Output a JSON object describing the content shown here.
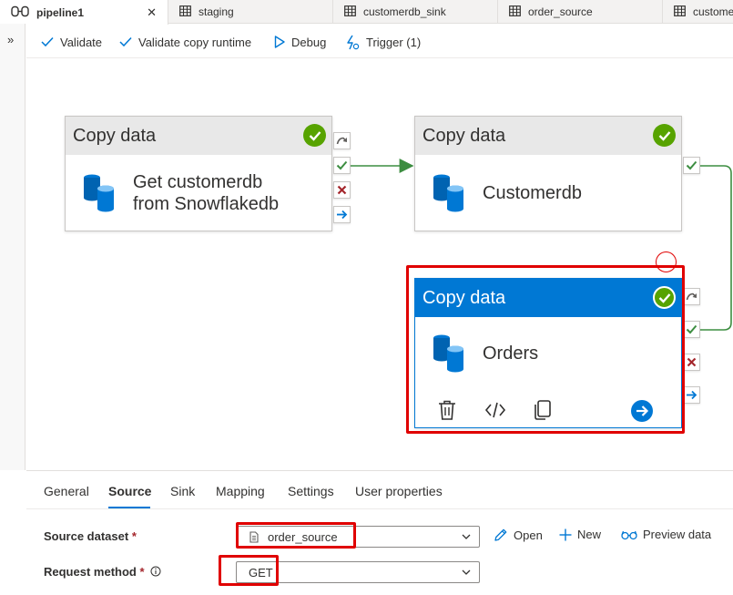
{
  "tabs": [
    {
      "label": "pipeline1",
      "icon": "pipeline-icon",
      "active": true,
      "close": "✕"
    },
    {
      "label": "staging",
      "icon": "table-icon"
    },
    {
      "label": "customerdb_sink",
      "icon": "table-icon"
    },
    {
      "label": "order_source",
      "icon": "table-icon"
    },
    {
      "label": "custome",
      "icon": "table-icon"
    }
  ],
  "rail": {
    "expand_glyph": "»"
  },
  "toolbar": {
    "validate": "Validate",
    "validate_copy_runtime": "Validate copy runtime",
    "debug": "Debug",
    "trigger": "Trigger (1)"
  },
  "activities": [
    {
      "type": "Copy data",
      "name_line1": "Get customerdb",
      "name_line2": "from Snowflakedb",
      "status": "succeeded"
    },
    {
      "type": "Copy data",
      "name": "Customerdb",
      "status": "succeeded"
    },
    {
      "type": "Copy data",
      "name": "Orders",
      "status": "succeeded",
      "selected": true
    }
  ],
  "colors": {
    "accent": "#0078d4",
    "success": "#57a300",
    "failure": "#a4262c",
    "highlight": "#e00000",
    "connector": "#3c8d40"
  },
  "panel": {
    "tabs": [
      "General",
      "Source",
      "Sink",
      "Mapping",
      "Settings",
      "User properties"
    ],
    "active_tab": "Source",
    "source_dataset_label": "Source dataset",
    "source_dataset_value": "order_source",
    "request_method_label": "Request method",
    "request_method_value": "GET",
    "required_mark": "*",
    "open": "Open",
    "new": "New",
    "preview_data": "Preview data"
  }
}
